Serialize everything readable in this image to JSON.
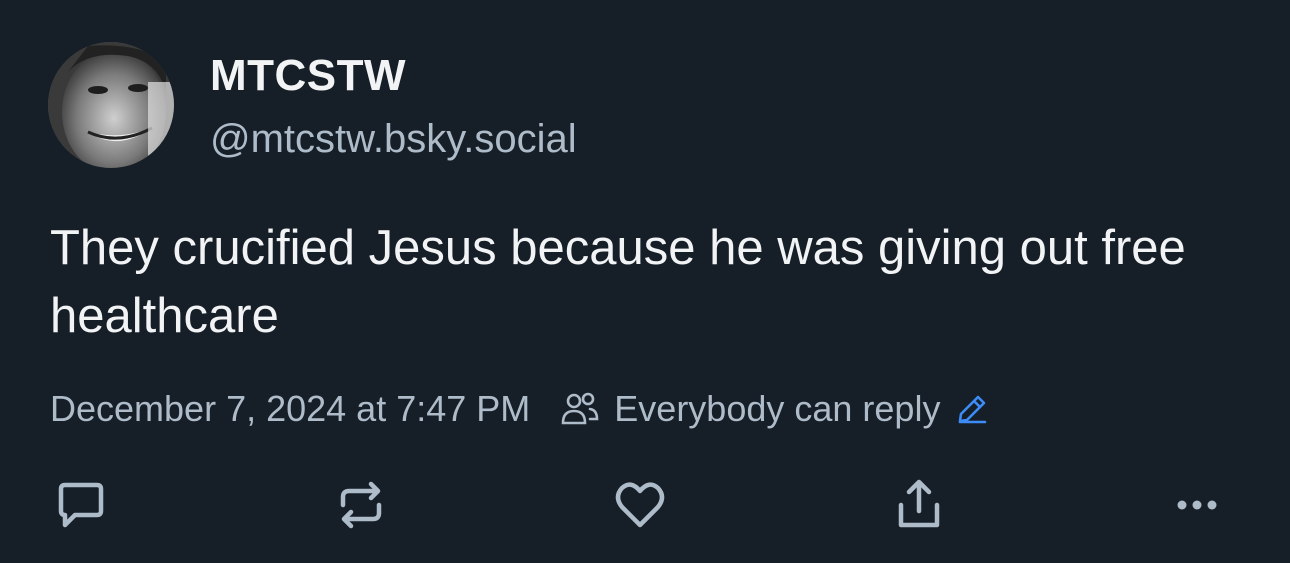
{
  "author": {
    "display_name": "MTCSTW",
    "handle": "@mtcstw.bsky.social"
  },
  "post": {
    "text": "They crucified Jesus because he was giving out free healthcare",
    "timestamp": "December 7, 2024 at 7:47 PM",
    "reply_setting": "Everybody can reply"
  },
  "actions": {
    "icons": [
      "reply-icon",
      "repost-icon",
      "like-icon",
      "share-icon",
      "more-icon"
    ]
  },
  "colors": {
    "background": "#161e27",
    "text_primary": "#f1f3f5",
    "text_secondary": "#aebbc9",
    "accent": "#3c8bf7"
  }
}
